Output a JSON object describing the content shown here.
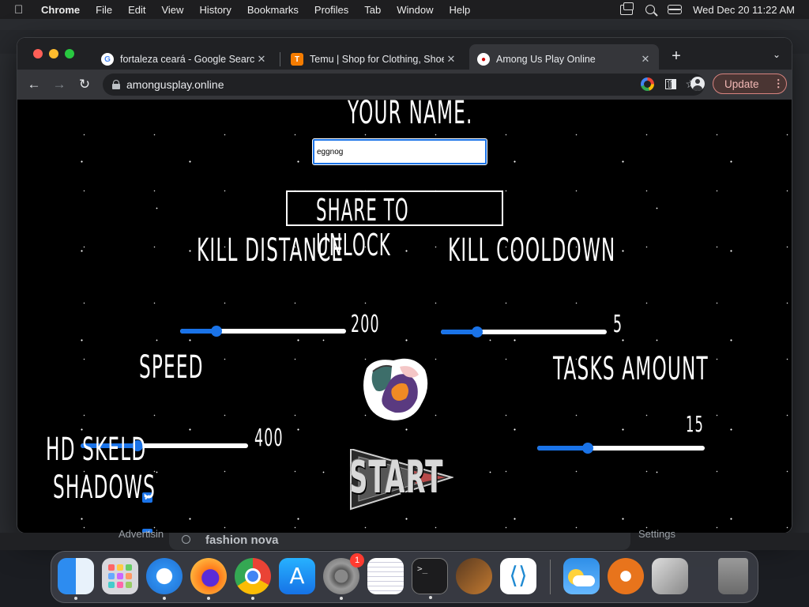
{
  "menubar": {
    "app_name": "Chrome",
    "menus": [
      "File",
      "Edit",
      "View",
      "History",
      "Bookmarks",
      "Profiles",
      "Tab",
      "Window",
      "Help"
    ],
    "datetime": "Wed Dec 20  11:22 AM"
  },
  "browser": {
    "tabs": [
      {
        "title": "fortaleza ceará - Google Search",
        "favicon": "google-icon"
      },
      {
        "title": "Temu | Shop for Clothing, Shoes",
        "favicon": "temu-icon"
      },
      {
        "title": "Among Us Play Online",
        "favicon": "among-us-icon",
        "active": true
      }
    ],
    "url": "amongusplay.online",
    "update_label": "Update"
  },
  "game": {
    "name_heading": "YOUR NAME.",
    "name_value": "eggnog",
    "share_label": "SHARE TO UNLOCK",
    "kill_distance": {
      "label": "KILL DISTANCE",
      "value": "200",
      "fraction": 0.22
    },
    "kill_cooldown": {
      "label": "KILL COOLDOWN",
      "value": "5",
      "fraction": 0.22
    },
    "speed": {
      "label": "SPEED",
      "value": "400",
      "fraction": 0.34
    },
    "tasks_amount": {
      "label": "TASKS AMOUNT",
      "value": "15",
      "fraction": 0.3
    },
    "hd_skeld": {
      "label": "HD SKELD",
      "checked": true
    },
    "shadows": {
      "label": "SHADOWS",
      "checked": true
    },
    "start_label": "START"
  },
  "under_page": {
    "left_text": "Advertisin",
    "search_text": "fashion nova",
    "right_text": "Settings"
  },
  "dock": {
    "apps": [
      "Finder",
      "Launchpad",
      "Safari",
      "Firefox",
      "Chrome",
      "App Store",
      "System Settings",
      "TextEdit",
      "Terminal",
      "GarageBand",
      "VS Code",
      "Weather",
      "Instruments",
      "Boot Camp",
      "Trash"
    ],
    "settings_badge": "1"
  }
}
